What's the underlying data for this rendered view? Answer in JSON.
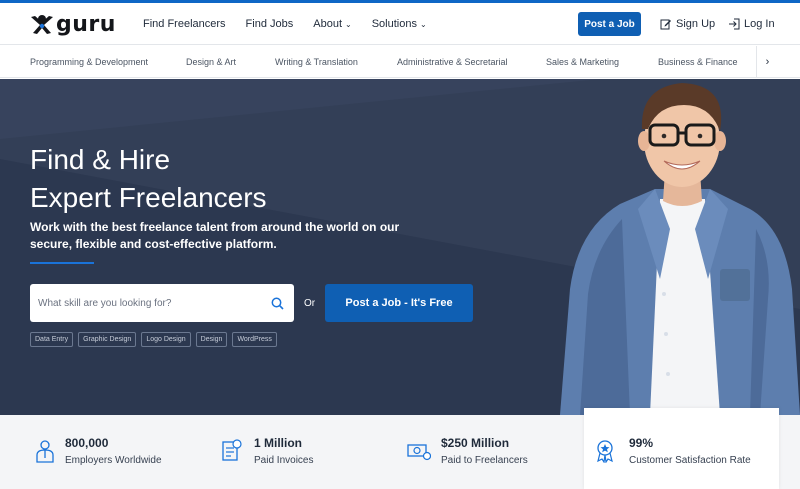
{
  "brand": {
    "name": "guru"
  },
  "nav": {
    "items": [
      {
        "label": "Find Freelancers",
        "dropdown": false
      },
      {
        "label": "Find Jobs",
        "dropdown": false
      },
      {
        "label": "About",
        "dropdown": true
      },
      {
        "label": "Solutions",
        "dropdown": true
      }
    ],
    "post_job": "Post a Job",
    "sign_up": "Sign Up",
    "log_in": "Log In"
  },
  "categories": [
    "Programming & Development",
    "Design & Art",
    "Writing & Translation",
    "Administrative & Secretarial",
    "Sales & Marketing",
    "Business & Finance"
  ],
  "hero": {
    "title_line1": "Find & Hire",
    "title_line2": "Expert Freelancers",
    "subtitle": "Work with the best freelance talent from around the world on our secure, flexible and cost-effective platform.",
    "search_placeholder": "What skill are you looking for?",
    "or": "Or",
    "cta": "Post a Job - It's Free",
    "tags": [
      "Data Entry",
      "Graphic Design",
      "Logo Design",
      "Design",
      "WordPress"
    ]
  },
  "stats": [
    {
      "value": "800,000",
      "label": "Employers Worldwide",
      "icon": "employer-icon"
    },
    {
      "value": "1 Million",
      "label": "Paid Invoices",
      "icon": "invoice-icon"
    },
    {
      "value": "$250 Million",
      "label": "Paid to Freelancers",
      "icon": "money-icon"
    },
    {
      "value": "99%",
      "label": "Customer Satisfaction Rate",
      "icon": "award-icon"
    }
  ],
  "colors": {
    "accent": "#0f5fb3",
    "hero_bg": "#2b364d",
    "top_line": "#0f67c6"
  }
}
